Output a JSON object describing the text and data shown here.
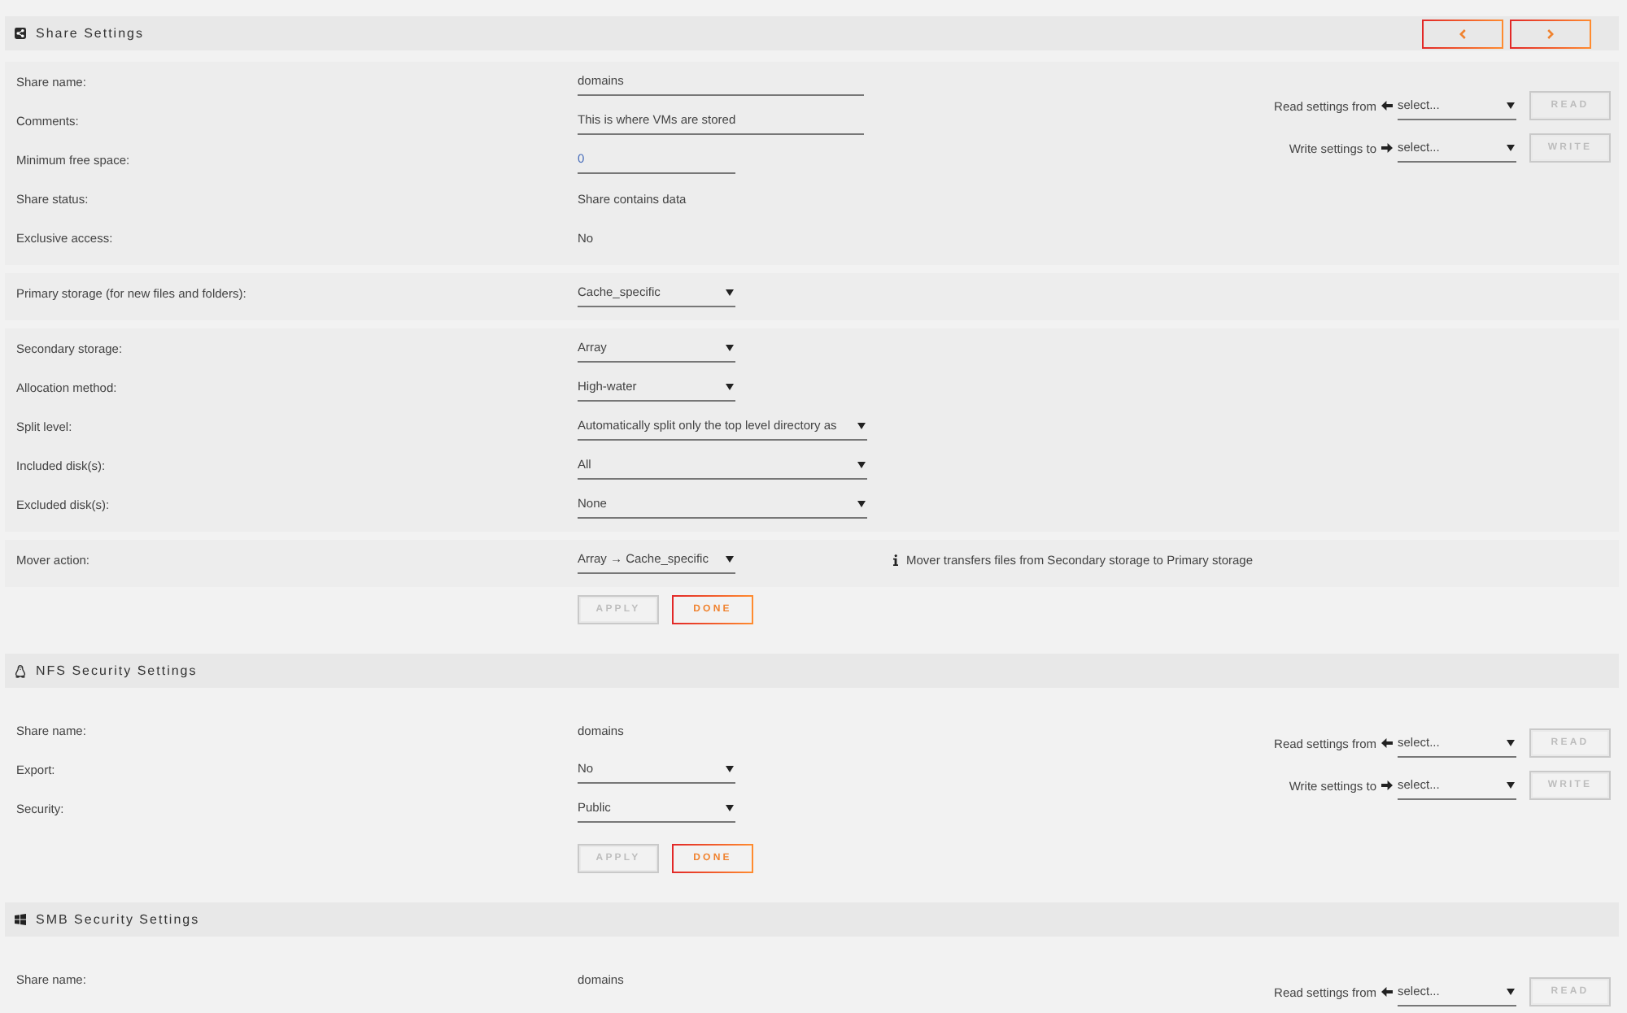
{
  "sections": [
    {
      "kind": "share",
      "title": "Share Settings",
      "nav_buttons": [
        {
          "kind": "previous",
          "disabled": false
        },
        {
          "kind": "next",
          "disabled": false
        }
      ],
      "groups": [
        {
          "rows": [
            {
              "label": "Share name:",
              "kind": "input",
              "value": "domains"
            },
            {
              "label": "Comments:",
              "kind": "input",
              "value": "This is where VMs are stored"
            },
            {
              "label": "Minimum free space:",
              "kind": "number",
              "value": "0"
            },
            {
              "label": "Share status:",
              "kind": "text",
              "value": "Share contains data"
            },
            {
              "label": "Exclusive access:",
              "kind": "text",
              "value": "No"
            }
          ],
          "transfer": [
            {
              "kind": "read",
              "label": "Read settings from",
              "value": "select...",
              "button": {
                "label": "READ",
                "disabled": true
              }
            },
            {
              "kind": "write",
              "label": "Write settings to",
              "value": "select...",
              "button": {
                "label": "WRITE",
                "disabled": true
              }
            }
          ]
        },
        {
          "rows": [
            {
              "label": "Primary storage (for new files and folders):",
              "kind": "select",
              "value": "Cache_specific"
            }
          ]
        },
        {
          "rows": [
            {
              "label": "Secondary storage:",
              "kind": "select",
              "value": "Array"
            },
            {
              "label": "Allocation method:",
              "kind": "select",
              "value": "High-water"
            },
            {
              "label": "Split level:",
              "kind": "wideselect",
              "value": "Automatically split only the top level directory as"
            },
            {
              "label": "Included disk(s):",
              "kind": "wideselect",
              "value": "All"
            },
            {
              "label": "Excluded disk(s):",
              "kind": "wideselect",
              "value": "None"
            }
          ]
        },
        {
          "rows": [
            {
              "label": "Mover action:",
              "kind": "select",
              "value": "Array → Cache_specific",
              "note": "Mover transfers files from Secondary storage to Primary storage"
            }
          ]
        }
      ],
      "actions": [
        {
          "label": "APPLY",
          "disabled": true
        },
        {
          "label": "DONE",
          "disabled": false
        }
      ]
    },
    {
      "kind": "nfs",
      "title": "NFS Security Settings",
      "groups": [
        {
          "rows": [
            {
              "label": "Share name:",
              "kind": "text",
              "value": "domains"
            },
            {
              "label": "Export:",
              "kind": "select",
              "value": "No"
            },
            {
              "label": "Security:",
              "kind": "select",
              "value": "Public"
            }
          ],
          "transfer": [
            {
              "kind": "read",
              "label": "Read settings from",
              "value": "select...",
              "button": {
                "label": "READ",
                "disabled": true
              }
            },
            {
              "kind": "write",
              "label": "Write settings to",
              "value": "select...",
              "button": {
                "label": "WRITE",
                "disabled": true
              }
            }
          ]
        }
      ],
      "actions": [
        {
          "label": "APPLY",
          "disabled": true
        },
        {
          "label": "DONE",
          "disabled": false
        }
      ]
    },
    {
      "kind": "smb",
      "title": "SMB Security Settings",
      "groups": [
        {
          "rows": [
            {
              "label": "Share name:",
              "kind": "text",
              "value": "domains"
            }
          ],
          "transfer": [
            {
              "kind": "read",
              "label": "Read settings from",
              "value": "select...",
              "button": {
                "label": "READ",
                "disabled": true
              }
            }
          ]
        }
      ]
    }
  ]
}
